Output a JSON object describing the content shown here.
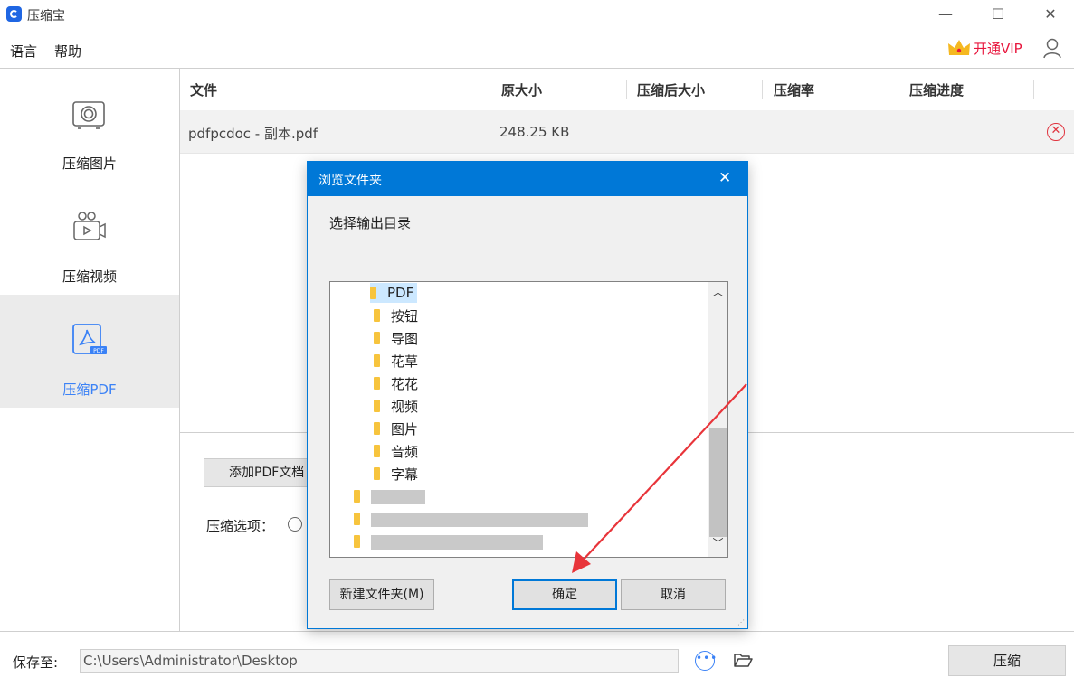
{
  "app": {
    "title": "压缩宝",
    "window_controls": {
      "minimize": "—",
      "maximize": "☐",
      "close": "✕"
    }
  },
  "menu": {
    "items": [
      "语言",
      "帮助"
    ],
    "vip_label": "开通VIP"
  },
  "sidebar": {
    "items": [
      {
        "label": "压缩图片",
        "icon": "image-icon",
        "active": false
      },
      {
        "label": "压缩视频",
        "icon": "video-icon",
        "active": false
      },
      {
        "label": "压缩PDF",
        "icon": "pdf-icon",
        "active": true
      }
    ],
    "active_color": "#3b82f6"
  },
  "table": {
    "columns": [
      "文件",
      "原大小",
      "压缩后大小",
      "压缩率",
      "压缩进度"
    ],
    "rows": [
      {
        "file": "pdfpcdoc - 副本.pdf",
        "original_size": "248.25 KB",
        "compressed_size": "",
        "ratio": "",
        "progress": ""
      }
    ]
  },
  "panel": {
    "add_button": "添加PDF文档",
    "options_label": "压缩选项："
  },
  "footer": {
    "save_label": "保存至:",
    "path_value": "C:\\Users\\Administrator\\Desktop",
    "compress_button": "压缩"
  },
  "dialog": {
    "title": "浏览文件夹",
    "close": "✕",
    "subtitle": "选择输出目录",
    "folders": [
      "PDF",
      "按钮",
      "导图",
      "花草",
      "花花",
      "视频",
      "图片",
      "音频",
      "字幕"
    ],
    "selected_folder": "PDF",
    "new_folder_button": "新建文件夹(M)",
    "ok_button": "确定",
    "cancel_button": "取消",
    "accent_color": "#0078d7"
  },
  "annotation": {
    "arrow_color": "#e8343a"
  }
}
